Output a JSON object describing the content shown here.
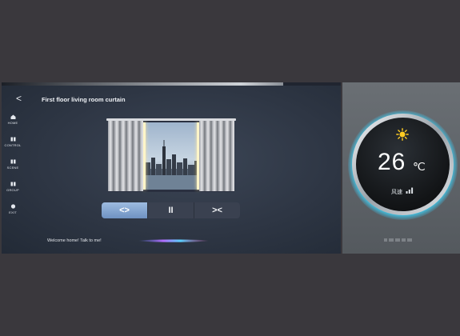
{
  "screen": {
    "title": "First floor living room curtain",
    "back_glyph": "<",
    "sidebar": [
      {
        "label": "HOME",
        "icon": "home-icon"
      },
      {
        "label": "CONTROL",
        "icon": "control-icon"
      },
      {
        "label": "SCENE",
        "icon": "scene-icon"
      },
      {
        "label": "GROUP",
        "icon": "group-icon"
      },
      {
        "label": "EXIT",
        "icon": "exit-icon"
      }
    ],
    "controls": {
      "open": "<>",
      "pause": "II",
      "close": "><"
    },
    "welcome": "Welcome home! Talk to me!"
  },
  "thermostat": {
    "temperature": "26",
    "unit": "℃",
    "wind_label": "风速",
    "ring_color": "#3bd8ff",
    "sun_color": "#ffcc22"
  },
  "colors": {
    "background": "#3a383d",
    "active_button": "#7fa0cc"
  }
}
